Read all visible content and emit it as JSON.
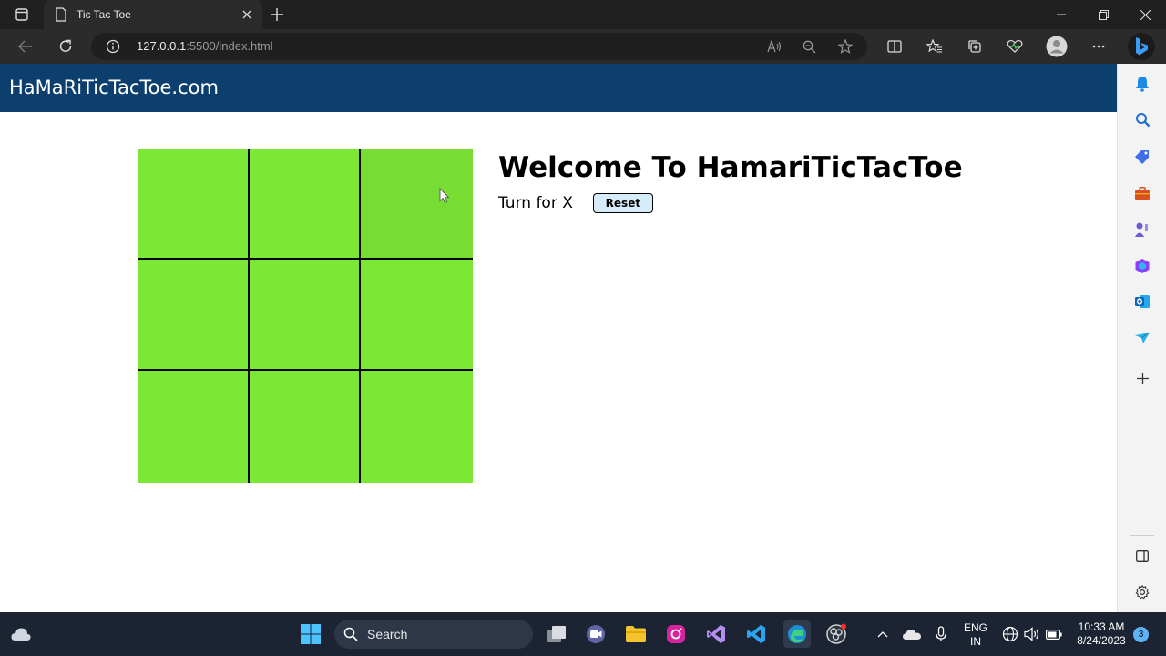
{
  "browser": {
    "tab_title": "Tic Tac Toe",
    "url_host": "127.0.0.1",
    "url_rest": ":5500/index.html"
  },
  "icons": {
    "tab_actions": "tab-actions-icon",
    "favicon": "page-favicon-icon",
    "back": "back-arrow-icon",
    "refresh": "refresh-icon",
    "info": "info-icon",
    "read_aloud": "read-aloud-icon",
    "zoom": "zoom-out-icon",
    "favorite": "star-icon",
    "split": "split-screen-icon",
    "favorites": "favorites-icon",
    "collections": "collections-icon",
    "performance": "heartbeat-icon",
    "profile": "profile-icon",
    "more": "more-icon",
    "copilot": "bing-icon"
  },
  "page": {
    "brand": "HaMaRiTicTacToe.com",
    "welcome": "Welcome To HamariTicTacToe",
    "turn": "Turn for X",
    "reset_label": "Reset",
    "board_color": "#7ae835",
    "nav_color": "#0d3f6e"
  },
  "taskbar": {
    "search_label": "Search",
    "lang_line1": "ENG",
    "lang_line2": "IN",
    "time": "10:33 AM",
    "date": "8/24/2023",
    "notif_count": "3"
  }
}
